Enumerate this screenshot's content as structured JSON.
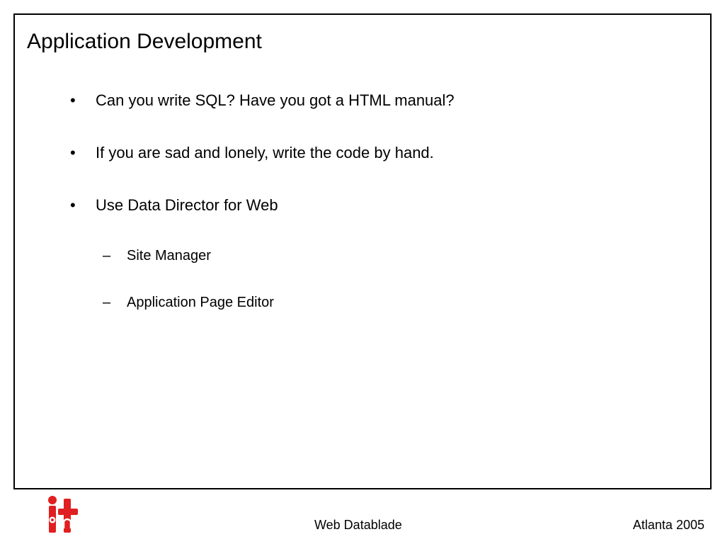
{
  "slide": {
    "title": "Application Development",
    "bullets": [
      {
        "marker": "•",
        "text": "Can you write SQL?  Have you got a HTML manual?"
      },
      {
        "marker": "•",
        "text": "If you are sad and lonely, write the code by hand."
      },
      {
        "marker": "•",
        "text": "Use Data Director for Web"
      }
    ],
    "sub_bullets": [
      {
        "marker": "–",
        "text": "Site Manager"
      },
      {
        "marker": "–",
        "text": "Application Page Editor"
      }
    ]
  },
  "footer": {
    "logo_icon": "iot-logo-icon",
    "center_text": "Web Datablade",
    "right_text": "Atlanta 2005"
  },
  "colors": {
    "logo_red": "#e02020",
    "text": "#000000",
    "border": "#000000"
  }
}
